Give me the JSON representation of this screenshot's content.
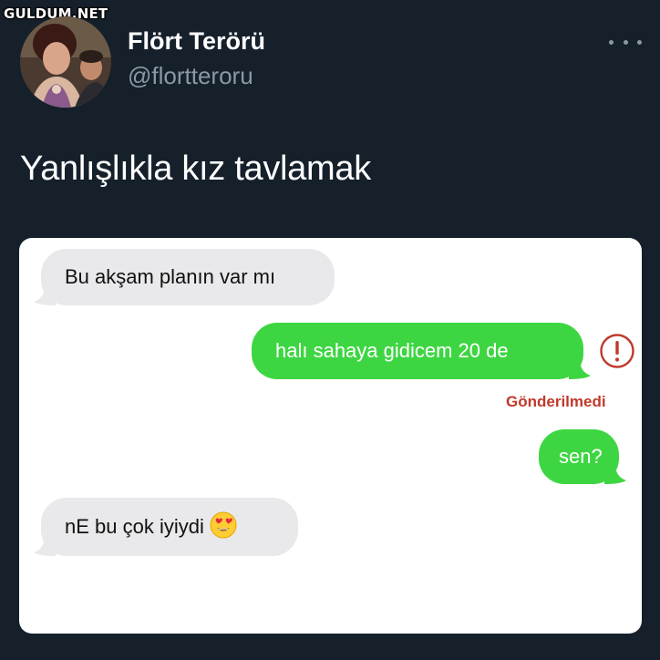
{
  "watermark": "GULDUM.NET",
  "author": {
    "display_name": "Flört Terörü",
    "handle": "@flortteroru",
    "avatar_icon": "profile-photo"
  },
  "menu_icon": "more-horizontal-icon",
  "tweet": {
    "text": "Yanlışlıkla kız tavlamak"
  },
  "chat": {
    "messages": [
      {
        "direction": "incoming",
        "text": "Bu akşam planın var mı"
      },
      {
        "direction": "outgoing",
        "text": "halı sahaya gidicem 20 de",
        "status": "Gönderilmedi",
        "status_icon": "exclamation-circle-icon"
      },
      {
        "direction": "outgoing",
        "text": "sen?"
      },
      {
        "direction": "incoming",
        "text": "nE bu çok iyiydi",
        "emoji": "heart-eyes-emoji"
      }
    ]
  },
  "colors": {
    "background": "#15202b",
    "secondary_text": "#8b98a5",
    "incoming_bubble": "#e9e9eb",
    "outgoing_bubble": "#3dd642",
    "error": "#c0392b"
  }
}
